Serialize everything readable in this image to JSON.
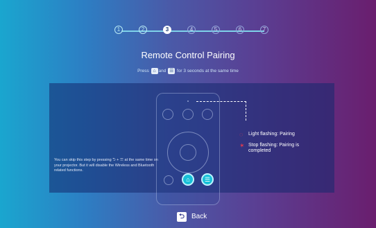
{
  "steps": [
    "1",
    "2",
    "3",
    "4",
    "5",
    "6",
    "7"
  ],
  "current_step": 3,
  "title": "Remote Control Pairing",
  "instruction": {
    "prefix": "Press",
    "and": "and",
    "suffix": "for 3 seconds at the same time"
  },
  "legend": {
    "flashing_label": "Light flashing: Pairing",
    "stop_label": "Stop flashing: Pairing is completed",
    "accent_color": "#e23b4f"
  },
  "skip_note": "You can skip this step by pressing ⮌ + ☰ at the same time on your projector. But it will disable the Wireless and Bluetooth related functions.",
  "back_label": "Back",
  "icons": [
    "home-icon",
    "menu-icon",
    "back-icon",
    "vol-icon"
  ]
}
